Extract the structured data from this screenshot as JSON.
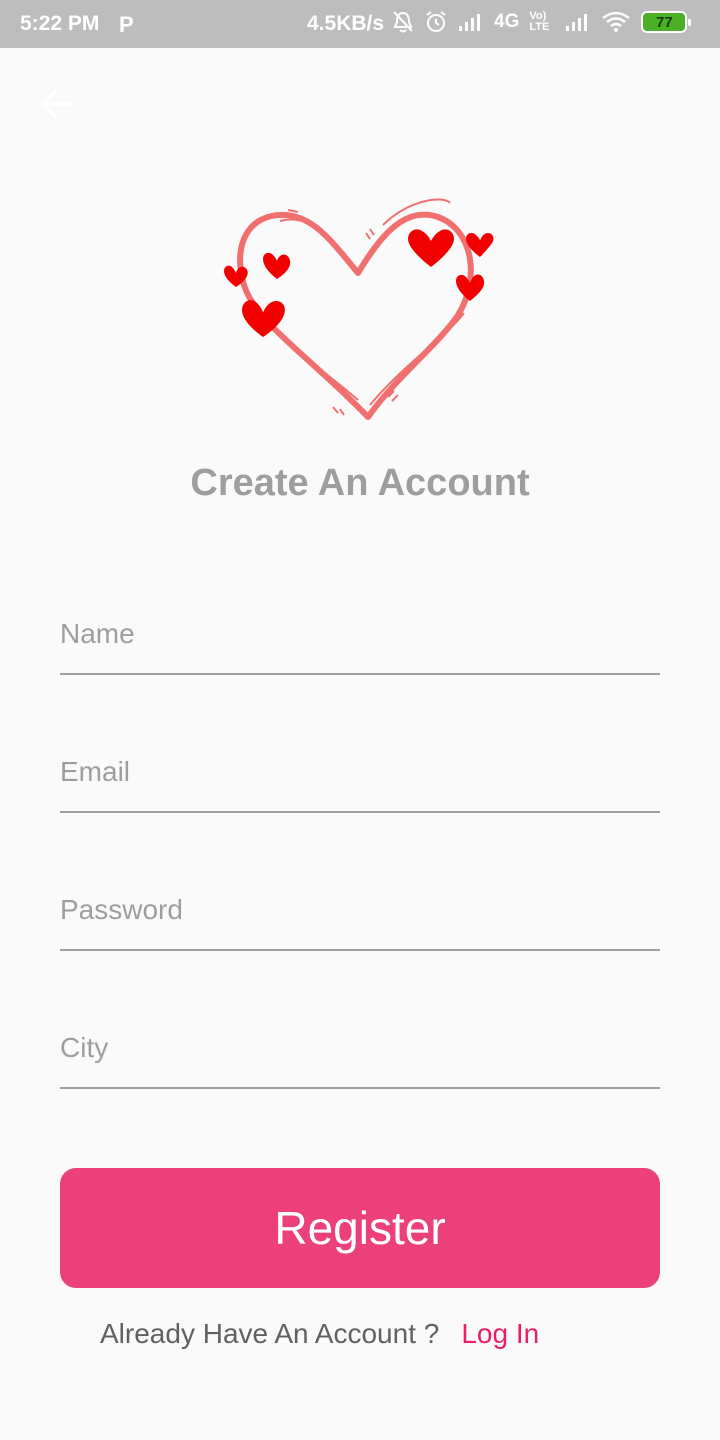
{
  "status_bar": {
    "time": "5:22 PM",
    "app_badge": "P",
    "net_speed": "4.5KB/s",
    "network_label": "4G",
    "volte_label": "Vo) LTE",
    "battery": "77",
    "battery_color": "#4caf28"
  },
  "header": {
    "back_icon": "arrow-left-icon"
  },
  "logo": {
    "icon": "hearts-logo-icon"
  },
  "title": "Create An Account",
  "form": {
    "name_placeholder": "Name",
    "email_placeholder": "Email",
    "password_placeholder": "Password",
    "city_placeholder": "City",
    "name_value": "",
    "email_value": "",
    "password_value": "",
    "city_value": ""
  },
  "register_label": "Register",
  "footer": {
    "prompt": "Already Have An Account ?",
    "login_label": "Log In"
  },
  "colors": {
    "accent": "#ec407a",
    "link": "#e91e63",
    "heart_outline": "#f07070",
    "heart_fill": "#f20000"
  }
}
